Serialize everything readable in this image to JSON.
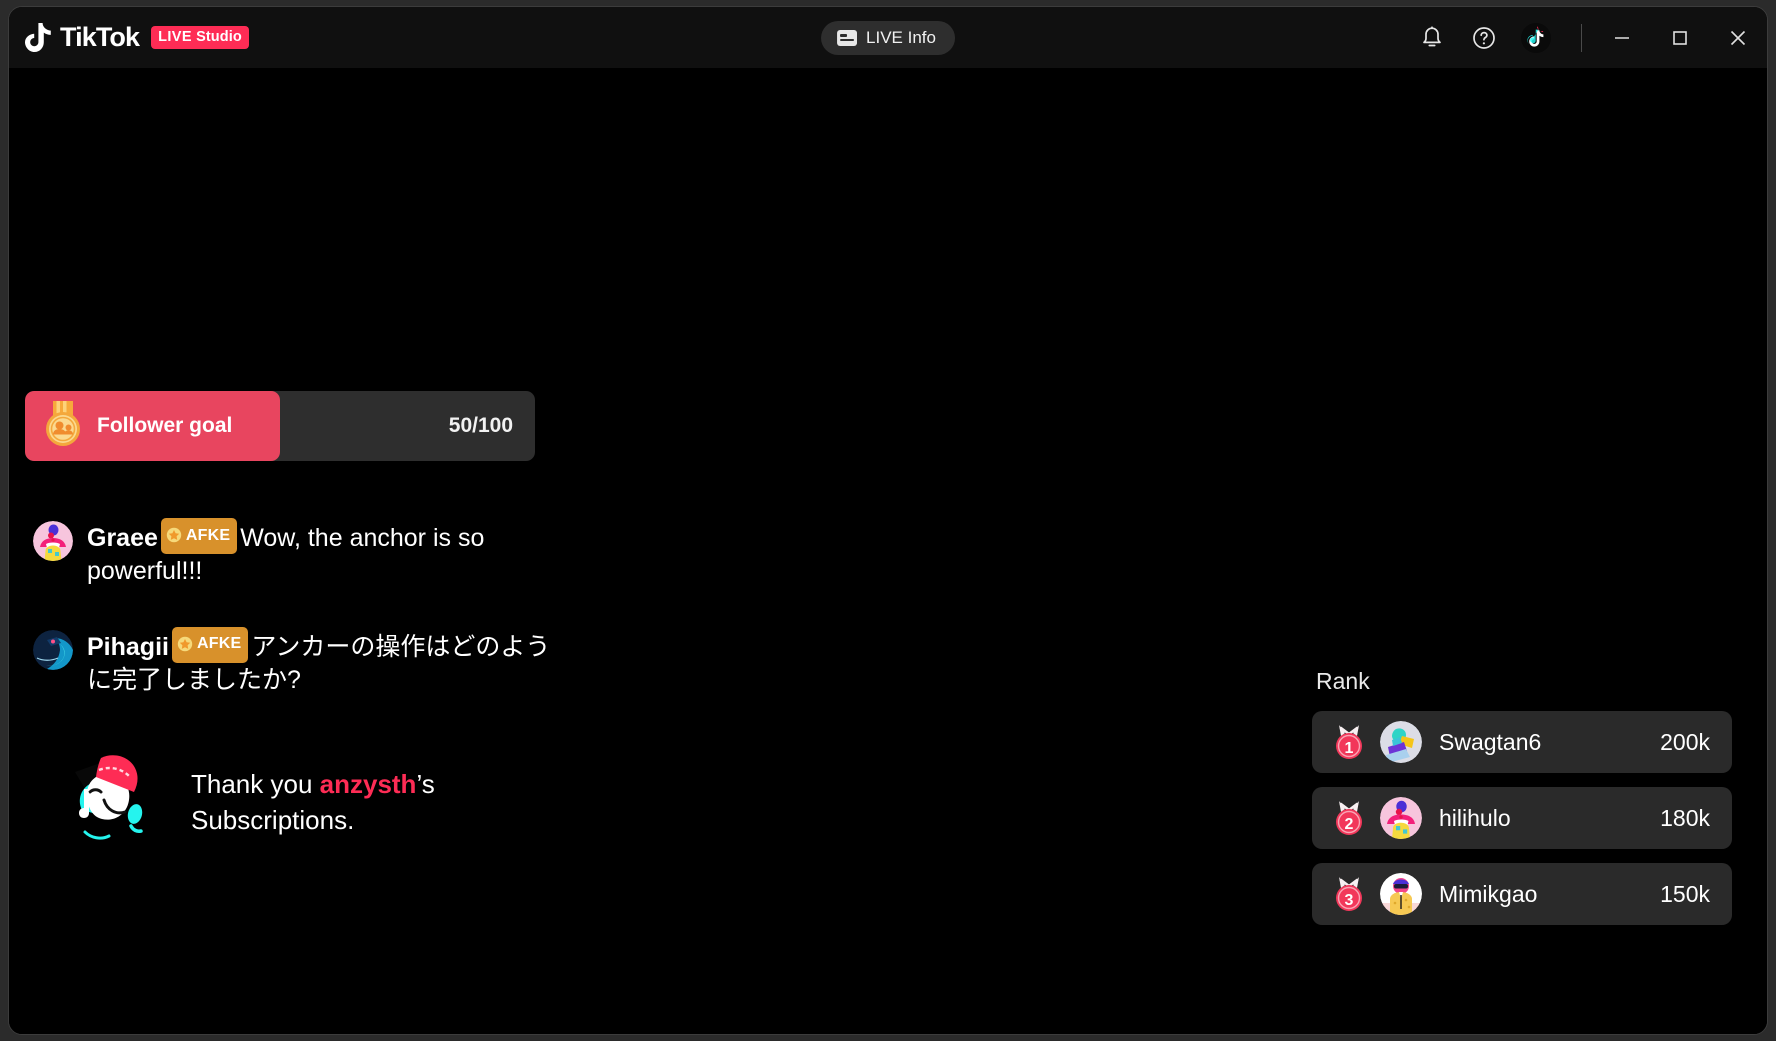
{
  "window": {
    "brand_name": "TikTok",
    "brand_badge_live": "LIVE",
    "brand_badge_studio": "Studio",
    "controls": {
      "minimize_label": "Minimize",
      "maximize_label": "Maximize",
      "close_label": "Close"
    }
  },
  "titlebar": {
    "live_info_label": "LIVE Info",
    "notifications_label": "Notifications",
    "help_label": "Help",
    "account_label": "Account"
  },
  "follower_goal": {
    "label": "Follower goal",
    "current": 50,
    "target": 100,
    "progress_text": "50/100",
    "percent": 50,
    "fill_color": "#e8455f",
    "track_color": "#2e2e2e"
  },
  "chat": {
    "messages": [
      {
        "username": "Graee",
        "badge": "AFKE",
        "text": "Wow, the anchor is so powerful!!!",
        "avatar": "pink-figure-avatar"
      },
      {
        "username": "Pihagii",
        "badge": "AFKE",
        "text": "アンカーの操作はどのように完了しましたか?",
        "avatar": "blue-night-avatar"
      }
    ],
    "badge_color": "#d8912b"
  },
  "subscription_toast": {
    "prefix": "Thank you ",
    "username": "anzysth",
    "suffix": "’s Subscriptions.",
    "username_color": "#fe2c55",
    "mascot": "tiktok-beanie-mascot"
  },
  "rank": {
    "title": "Rank",
    "rows": [
      {
        "position": "1",
        "name": "Swagtan6",
        "score": "200k",
        "avatar": "teal-yellow-abstract-avatar"
      },
      {
        "position": "2",
        "name": "hilihulo",
        "score": "180k",
        "avatar": "pink-figure-avatar"
      },
      {
        "position": "3",
        "name": "Mimikgao",
        "score": "150k",
        "avatar": "yellow-jacket-avatar"
      }
    ],
    "medal_color": "#f2375a",
    "row_background": "#2a2a2a"
  }
}
